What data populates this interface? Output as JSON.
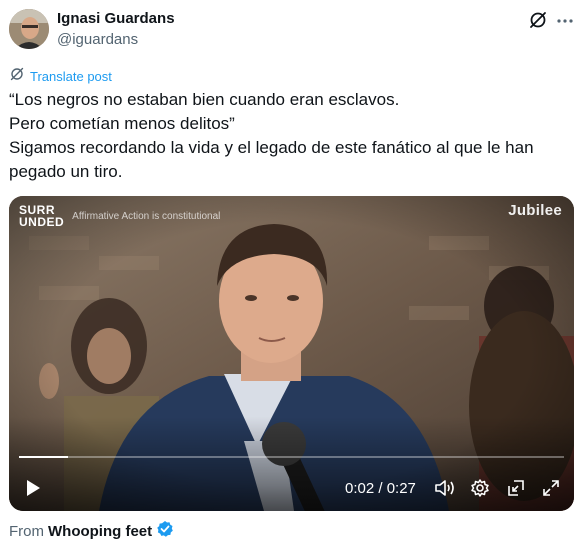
{
  "author": {
    "name": "Ignasi Guardans",
    "handle": "@iguardans"
  },
  "header_actions": {
    "grok_icon": "grok-icon",
    "more_icon": "more-icon"
  },
  "translate": {
    "label": "Translate post",
    "icon": "grok-icon"
  },
  "tweet": {
    "lines": [
      "“Los negros no estaban bien cuando eran esclavos.",
      "Pero cometían menos delitos”",
      "Sigamos recordando la vida y el legado de este fanático al que le han",
      "pegado un tiro."
    ]
  },
  "video": {
    "overlay_logo_line1": "SURR",
    "overlay_logo_line2": "UNDED",
    "overlay_subtitle": "Affirmative Action is constitutional",
    "brand": "Jubilee",
    "progress_fraction": 0.09,
    "time": "0:02 / 0:27",
    "controls": [
      "play-icon",
      "volume-icon",
      "settings-icon",
      "minimize-icon",
      "fullscreen-icon"
    ]
  },
  "source": {
    "prefix": "From",
    "name": "Whooping feet",
    "verified_color": "#1d9bf0"
  },
  "colors": {
    "accent": "#1d9bf0",
    "text": "#0f1419",
    "secondary": "#536471"
  }
}
